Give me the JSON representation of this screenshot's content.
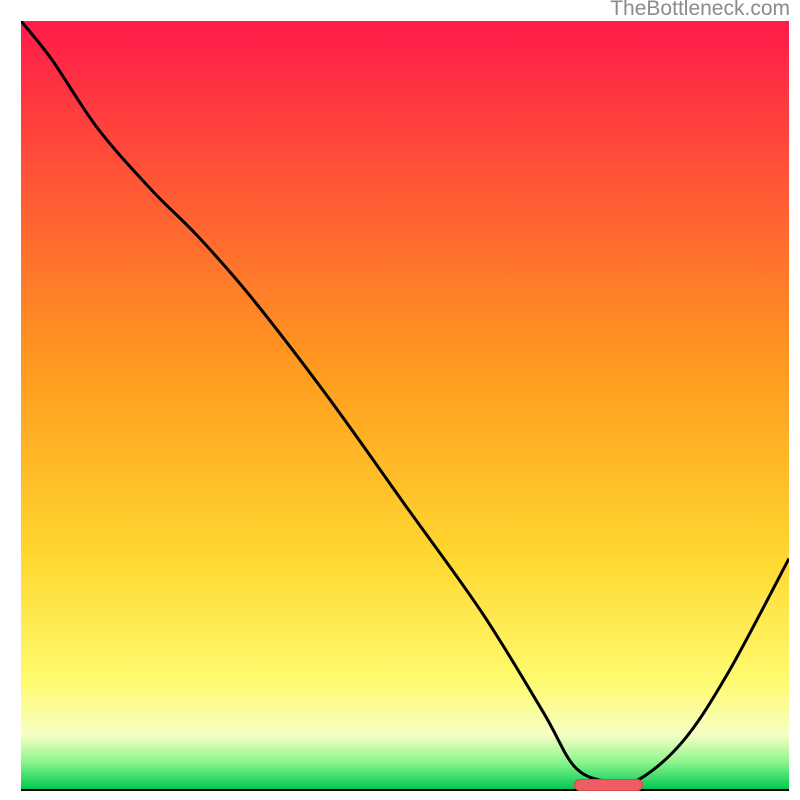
{
  "watermark": "TheBottleneck.com",
  "colors": {
    "grad_top": "#ff1a4a",
    "grad_yellow_mid": "#ffd830",
    "grad_yellow_low": "#fffb70",
    "grad_pale": "#f6ffc4",
    "grad_green_hi": "#8cf58c",
    "grad_green_lo": "#00c853",
    "curve": "#000000",
    "pill_fill": "#ef5d63",
    "pill_stroke": "#d24b51"
  },
  "chart_data": {
    "type": "line",
    "title": "",
    "xlabel": "",
    "ylabel": "",
    "xlim": [
      0,
      1
    ],
    "ylim": [
      0,
      1
    ],
    "x": [
      0.0,
      0.04,
      0.1,
      0.17,
      0.23,
      0.3,
      0.4,
      0.5,
      0.6,
      0.68,
      0.72,
      0.76,
      0.8,
      0.86,
      0.92,
      1.0
    ],
    "values": [
      1.0,
      0.95,
      0.86,
      0.78,
      0.72,
      0.64,
      0.51,
      0.37,
      0.23,
      0.1,
      0.03,
      0.01,
      0.01,
      0.06,
      0.15,
      0.3
    ],
    "optimal_region": {
      "x_start": 0.72,
      "x_end": 0.81,
      "y": 0.005
    },
    "annotations": []
  }
}
